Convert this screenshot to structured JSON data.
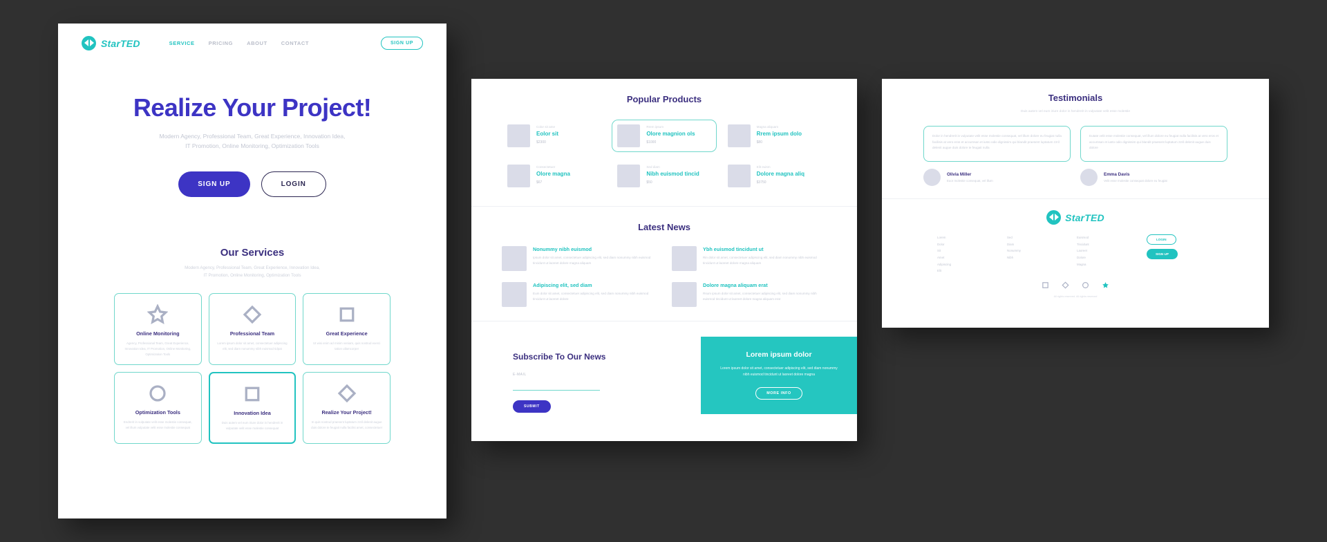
{
  "brand": {
    "name": "StarTED",
    "accent_teal": "#21c3c0",
    "accent_purple": "#3d34c4"
  },
  "home": {
    "nav": [
      {
        "label": "SERVICE",
        "active": true
      },
      {
        "label": "PRICING",
        "active": false
      },
      {
        "label": "ABOUT",
        "active": false
      },
      {
        "label": "CONTACT",
        "active": false
      }
    ],
    "header_cta": "SIGN UP",
    "hero": {
      "title": "Realize Your Project!",
      "subtitle_line1": "Modern Agency, Professional Team, Great Experience, Innovation Idea,",
      "subtitle_line2": "IT Promotion, Online Monitoring, Optimization Tools",
      "primary_button": "SIGN UP",
      "secondary_button": "LOGIN"
    },
    "services": {
      "title": "Our Services",
      "subtitle_line1": "Modern Agency, Professional Team, Great Experience, Innovation Idea,",
      "subtitle_line2": "IT Promotion, Online Monitoring, Optimization Tools",
      "cards": [
        {
          "icon": "star-icon",
          "title": "Online Monitoring",
          "body": "Agency, Professional Team, Great Experience, Innovation Idea, IT Promotion, Online Monitoring, Optimization Tools",
          "highlight": false
        },
        {
          "icon": "diamond-icon",
          "title": "Professional Team",
          "body": "Lorem ipsum dolor sit amet, consectetuer adipiscing elit, sed diam nonummy nibh euismod tidpat",
          "highlight": false
        },
        {
          "icon": "square-icon",
          "title": "Great Experience",
          "body": "Ut wisi enim ad minim veniam, quis nostrud exerci tation ullamcorper",
          "highlight": false
        },
        {
          "icon": "circle-icon",
          "title": "Optimization Tools",
          "body": "Endrerit in vulputate velit esse molestie consequat, vel illum vulputate velit esse molestie consequat",
          "highlight": false
        },
        {
          "icon": "square-icon",
          "title": "Innovation Idea",
          "body": "Duis autem vel eum iriure dolor in hendrerit in vulputate velit esse molestie consequat",
          "highlight": true
        },
        {
          "icon": "diamond-icon",
          "title": "Realize Your Project!",
          "body": "In quis nostrud praesent luptatum zzril delenit augue duis dolore te feugait nulla facilisi amet, consectetuer",
          "highlight": false
        }
      ]
    }
  },
  "mid": {
    "products": {
      "title": "Popular Products",
      "items": [
        {
          "kicker": "Color sit ame",
          "name": "Eolor sit",
          "price": "$2300",
          "highlight": false
        },
        {
          "kicker": "Rrem ipsum",
          "name": "Olore magnion ols",
          "price": "$1000",
          "highlight": true
        },
        {
          "kicker": "Magna aliquam",
          "name": "Rrem ipsum dolo",
          "price": "$80",
          "highlight": false
        },
        {
          "kicker": "Consectetuer",
          "name": "Olore magna",
          "price": "$67",
          "highlight": false
        },
        {
          "kicker": "Sed diam",
          "name": "Nibh euismod tincid",
          "price": "$50",
          "highlight": false
        },
        {
          "kicker": "Elit euism",
          "name": "Dolore magna aliq",
          "price": "$3750",
          "highlight": false
        }
      ]
    },
    "news": {
      "title": "Latest News",
      "items": [
        {
          "title": "Nonummy nibh euismod",
          "body": "Ipsum dolor sit amet, consectetuer adipiscing elit, sed diam nonummy nibh euismod tincidunt ut laoreet dolore magna aliquam"
        },
        {
          "title": "Ybh euismod tincidunt ut",
          "body": "Rin dolor sit amet, consectetuer adipiscing elit, sed diam nonummy nibh euismod tincidunt ut laoreet dolore magna aliquam"
        },
        {
          "title": "Adipiscing elit, sed diam",
          "body": "Eum dolor sit amet, consectetuer adipiscing elit, sed diam nonummy nibh euismod tincidunt ut laoreet dolore"
        },
        {
          "title": "Dolore magna aliquam erat",
          "body": "Rsum ipsum dolor sit amet, consectetuer adipiscing elit, sed diam nonummy nibh euismod tincidunt ut laoreet dolore magna aliquam erat"
        }
      ]
    },
    "subscribe": {
      "title": "Subscribe To Our News",
      "field_label": "E-MAIL",
      "field_value": "",
      "field_placeholder": "",
      "button": "SUBMIT"
    },
    "promo": {
      "title": "Lorem ipsum dolor",
      "body": "Lorem ipsum dolor sit amet, consectetuer adipiscing elit, sed diam nonummy nibh euismod tincidunt ut laoreet dolore magna",
      "button": "MORE INFO"
    }
  },
  "right": {
    "testimonials": {
      "title": "Testimonials",
      "subtitle": "Duis autem vel eum iriure dolor in hendrerit in vulputate velit esse molestie",
      "items": [
        {
          "quote": "Dolor in hendrerit in vulputate velit esse molestie consequat, vel illum dolore eu feugiat nulla facilisis at vero eros et accumsan et iusto odio dignissim qui blandit praesent luptatum zzril delenit augue duis dolore te feugait nulla",
          "name": "Olivia Miller",
          "role": "Euor molestie consequat, vel illum"
        },
        {
          "quote": "Eutate velit esse molestie consequat, vel illum dolore eu feugiat nulla facilisis at vero eros et accumsan et iusto odio dignissim qui blandit praesent luptatum zzril delenit augue duis dolore",
          "name": "Emma Davis",
          "role": "Velit esse molestie consequat dolore eu feugiat"
        }
      ]
    },
    "footer": {
      "columns": [
        [
          "Lorem",
          "Dolor",
          "Sit",
          "Amet",
          "Adipiscing",
          "Elit"
        ],
        [
          "Sed",
          "Diam",
          "Nonummy",
          "Nibh"
        ],
        [
          "Euismod",
          "Tincidunt",
          "Laoreet",
          "Dolore",
          "Magna"
        ]
      ],
      "login_button": "LOGIN",
      "signup_button": "SIGN UP",
      "social_icons": [
        "square-icon",
        "diamond-icon",
        "circle-icon",
        "star-icon"
      ],
      "copyright": "All rights reserved. All rights reserved"
    }
  }
}
